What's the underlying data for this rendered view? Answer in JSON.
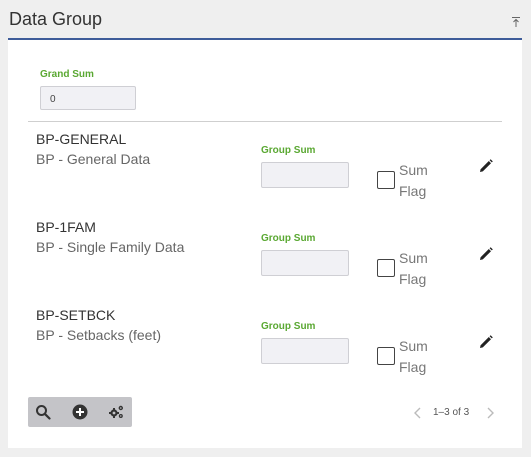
{
  "header": {
    "title": "Data Group",
    "collapse_icon": "collapse-to-top-icon"
  },
  "grand_sum": {
    "label": "Grand Sum",
    "value": "0"
  },
  "rows": [
    {
      "code": "BP-GENERAL",
      "description": "BP - General Data",
      "group_sum_label": "Group Sum",
      "group_sum_value": "",
      "sum_flag_label": "Sum Flag",
      "sum_flag_checked": false
    },
    {
      "code": "BP-1FAM",
      "description": "BP - Single Family Data",
      "group_sum_label": "Group Sum",
      "group_sum_value": "",
      "sum_flag_label": "Sum Flag",
      "sum_flag_checked": false
    },
    {
      "code": "BP-SETBCK",
      "description": "BP - Setbacks (feet)",
      "group_sum_label": "Group Sum",
      "group_sum_value": "",
      "sum_flag_label": "Sum Flag",
      "sum_flag_checked": false
    }
  ],
  "toolbar": {
    "icons": [
      "search-icon",
      "add-circle-icon",
      "settings-gears-icon"
    ]
  },
  "pager": {
    "text": "1–3 of 3"
  },
  "colors": {
    "accent_label": "#5aa832",
    "header_rule": "#3e5c99",
    "toolbar_bg": "#c4c4c8"
  }
}
